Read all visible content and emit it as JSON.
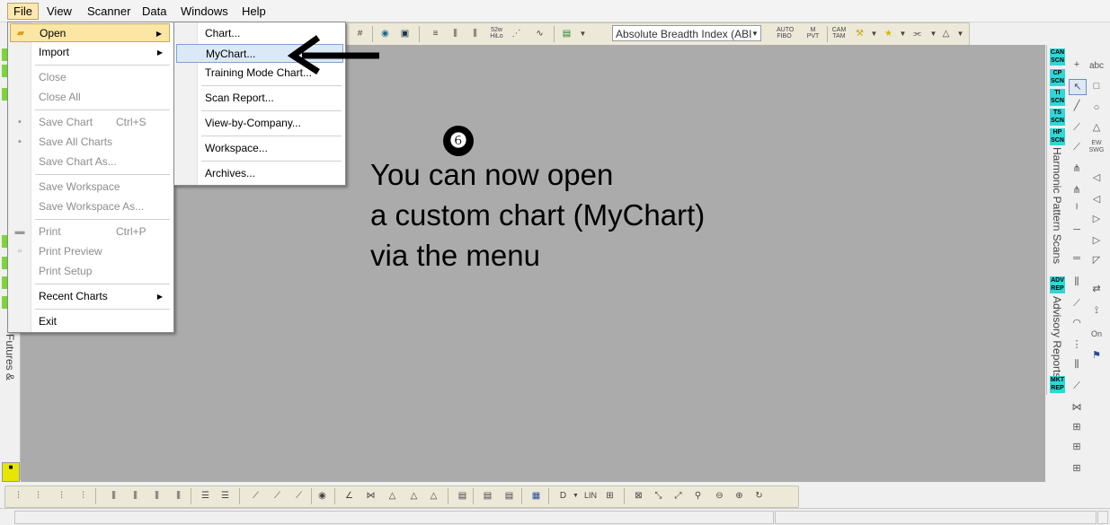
{
  "menubar": {
    "items": [
      {
        "label": "File"
      },
      {
        "label": "View"
      },
      {
        "label": "Scanner"
      },
      {
        "label": "Data"
      },
      {
        "label": "Windows"
      },
      {
        "label": "Help"
      }
    ]
  },
  "toolbar": {
    "symbol_value": "Absolute Breadth Index (ABI",
    "icons": [
      "52w HiLo",
      "AUTO FIBO",
      "M PVT",
      "CAM TAM"
    ]
  },
  "file_menu": {
    "items": [
      {
        "label": "Open",
        "shortcut": "",
        "submenu": true,
        "disabled": false
      },
      {
        "label": "Import",
        "shortcut": "",
        "submenu": true,
        "disabled": false
      },
      {
        "label": "Close",
        "shortcut": "",
        "submenu": false,
        "disabled": true
      },
      {
        "label": "Close All",
        "shortcut": "",
        "submenu": false,
        "disabled": true
      },
      {
        "label": "Save Chart",
        "shortcut": "Ctrl+S",
        "submenu": false,
        "disabled": true
      },
      {
        "label": "Save All Charts",
        "shortcut": "",
        "submenu": false,
        "disabled": true
      },
      {
        "label": "Save Chart As...",
        "shortcut": "",
        "submenu": false,
        "disabled": true
      },
      {
        "label": "Save Workspace",
        "shortcut": "",
        "submenu": false,
        "disabled": true
      },
      {
        "label": "Save Workspace As...",
        "shortcut": "",
        "submenu": false,
        "disabled": true
      },
      {
        "label": "Print",
        "shortcut": "Ctrl+P",
        "submenu": false,
        "disabled": true
      },
      {
        "label": "Print Preview",
        "shortcut": "",
        "submenu": false,
        "disabled": true
      },
      {
        "label": "Print Setup",
        "shortcut": "",
        "submenu": false,
        "disabled": true
      },
      {
        "label": "Recent Charts",
        "shortcut": "",
        "submenu": true,
        "disabled": false
      },
      {
        "label": "Exit",
        "shortcut": "",
        "submenu": false,
        "disabled": false
      }
    ]
  },
  "open_submenu": {
    "items": [
      {
        "label": "Chart..."
      },
      {
        "label": "MyChart..."
      },
      {
        "label": "Training Mode Chart..."
      },
      {
        "label": "Scan Report..."
      },
      {
        "label": "View-by-Company..."
      },
      {
        "label": "Workspace..."
      },
      {
        "label": "Archives..."
      }
    ]
  },
  "annotation": {
    "step_number": "❻",
    "caption_lines": [
      "You can now open",
      "a custom chart (MyChart)",
      "via the menu"
    ]
  },
  "left_panel": {
    "vertical_label": "Futures & Options"
  },
  "right_panel": {
    "scan_tiles": [
      "CAN SCN",
      "CP SCN",
      "TI SCN",
      "TS SCN",
      "HP SCN"
    ],
    "harmonic_label": "Harmonic Pattern Scans",
    "report_tiles": [
      "ADV REP",
      "MKT REP"
    ],
    "advisory_label": "Advisory Reports",
    "draw_labels": [
      "abc",
      "EW SWG",
      "On"
    ]
  },
  "bottom_toolbar": {
    "labels": [
      "LIN"
    ]
  },
  "colors": {
    "main_background": "#ababab",
    "menu_highlight": "#fbe6a4",
    "submenu_highlight": "#dbe9f7",
    "scan_tile": "#31d6d6"
  }
}
